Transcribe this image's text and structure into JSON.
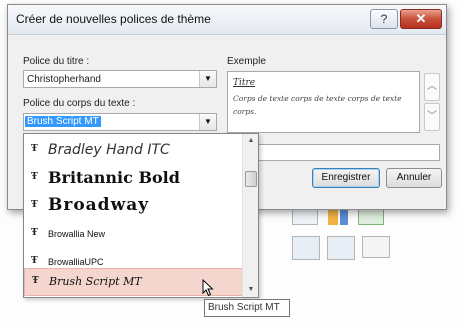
{
  "dialog": {
    "title": "Créer de nouvelles polices de thème",
    "help_glyph": "?",
    "close_glyph": "✕"
  },
  "heading_font": {
    "label": "Police du titre :",
    "value": "Christopherhand"
  },
  "body_font": {
    "label": "Police du corps du texte :",
    "value": "Brush Script MT"
  },
  "preview": {
    "label": "Exemple",
    "title_text": "Titre",
    "body_text": "Corps de texte corps de texte corps de texte corps."
  },
  "buttons": {
    "save": "Enregistrer",
    "cancel": "Annuler"
  },
  "font_list": {
    "items": [
      {
        "name": "Bradley Hand ITC"
      },
      {
        "name": "Britannic Bold"
      },
      {
        "name": "Broadway"
      },
      {
        "name": "Browallia New"
      },
      {
        "name": "BrowalliaUPC"
      },
      {
        "name": "Brush Script MT"
      }
    ],
    "type_glyph": "Ŧ",
    "hovered_index": 5
  },
  "tooltip": "Brush Script MT",
  "colors": {
    "selection": "#3399ff",
    "hover_item": "#f5d6cf",
    "close_button": "#c8503a"
  }
}
